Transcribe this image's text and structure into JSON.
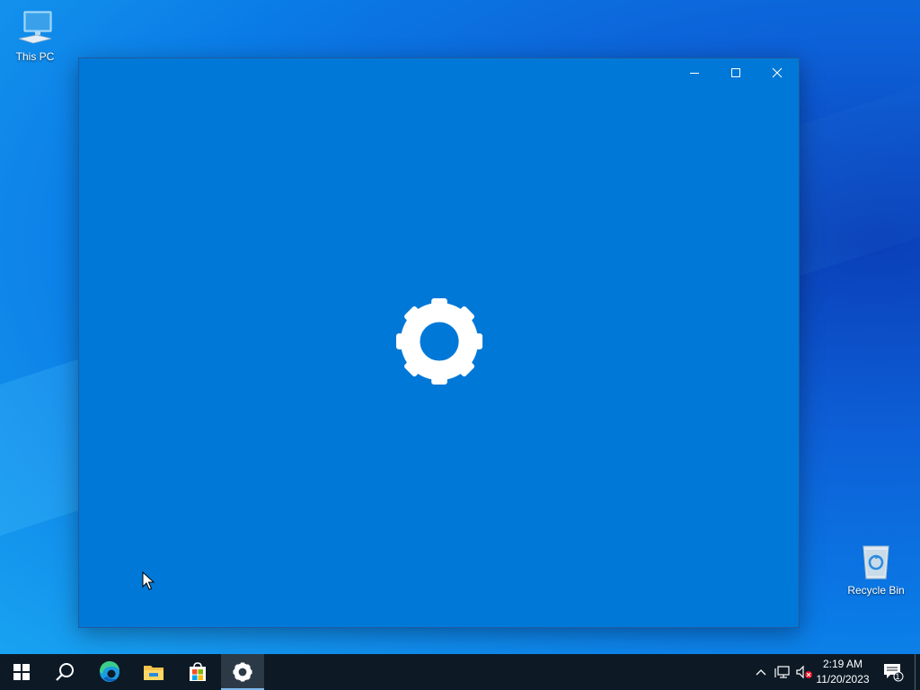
{
  "desktop": {
    "icons": [
      {
        "label": "This PC",
        "icon": "this-pc-icon"
      },
      {
        "label": "Recycle Bin",
        "icon": "recycle-bin-icon"
      }
    ]
  },
  "window": {
    "splash_icon": "gear-icon",
    "caption_buttons": [
      "minimize",
      "maximize",
      "close"
    ]
  },
  "taskbar": {
    "items": [
      {
        "name": "start",
        "icon": "windows-logo-icon"
      },
      {
        "name": "search",
        "icon": "search-icon"
      },
      {
        "name": "edge",
        "icon": "edge-icon"
      },
      {
        "name": "file-explorer",
        "icon": "folder-icon"
      },
      {
        "name": "store",
        "icon": "store-icon"
      },
      {
        "name": "settings",
        "icon": "gear-icon",
        "active": true
      }
    ],
    "tray": {
      "time": "2:19 AM",
      "date": "11/20/2023",
      "notification_count": "1"
    }
  },
  "colors": {
    "window_bg": "#0078d7",
    "taskbar_bg": "#0d1a26",
    "active_underline": "#7cb7ea"
  }
}
